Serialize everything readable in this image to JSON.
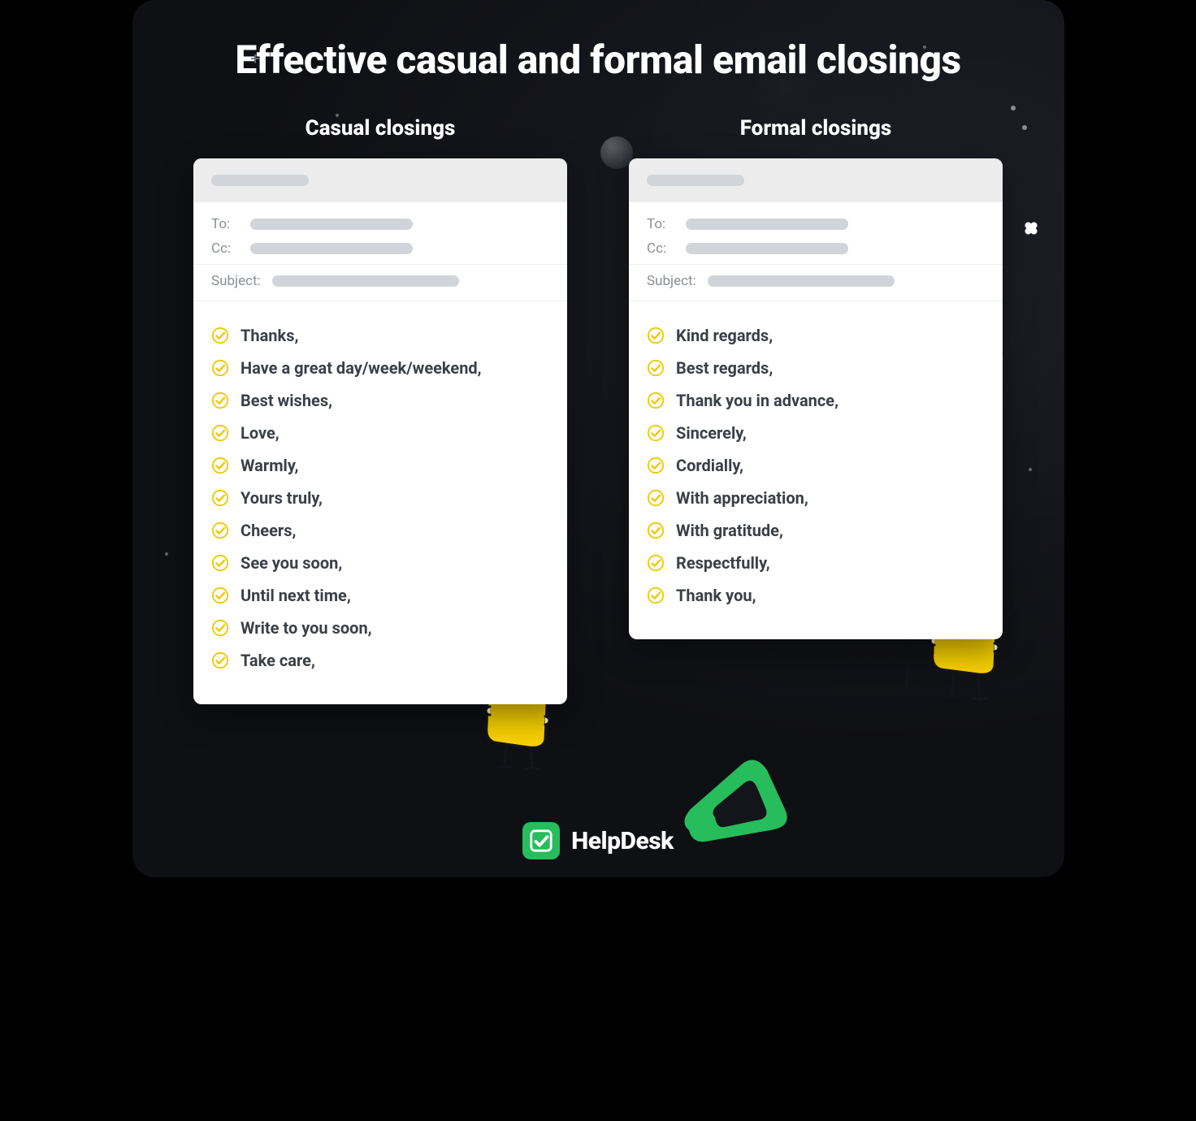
{
  "header": {
    "title": "Effective casual and formal email closings"
  },
  "columns": {
    "casual": {
      "heading": "Casual closings",
      "fields": {
        "to": "To:",
        "cc": "Cc:",
        "subject": "Subject:"
      },
      "items": [
        "Thanks,",
        "Have a great day/week/weekend,",
        "Best wishes,",
        "Love,",
        "Warmly,",
        "Yours truly,",
        "Cheers,",
        "See you soon,",
        "Until next time,",
        "Write to you soon,",
        "Take care,"
      ]
    },
    "formal": {
      "heading": "Formal closings",
      "fields": {
        "to": "To:",
        "cc": "Cc:",
        "subject": "Subject:"
      },
      "items": [
        "Kind regards,",
        "Best regards,",
        "Thank you in advance,",
        "Sincerely,",
        "Cordially,",
        "With appreciation,",
        "With gratitude,",
        "Respectfully,",
        "Thank you,"
      ]
    }
  },
  "footer": {
    "brand": "HelpDesk"
  }
}
